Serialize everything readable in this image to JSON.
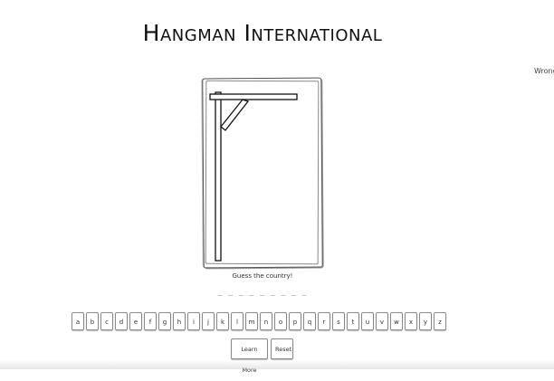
{
  "game": {
    "title": "Hangman International",
    "wrong_label": "Wrong gu",
    "prompt": "Guess the country!",
    "blanks": "_ _ _ _ _ _ _ _ _"
  },
  "keyboard": {
    "letters": [
      "a",
      "b",
      "c",
      "d",
      "e",
      "f",
      "g",
      "h",
      "i",
      "j",
      "k",
      "l",
      "m",
      "n",
      "o",
      "p",
      "q",
      "r",
      "s",
      "t",
      "u",
      "v",
      "w",
      "x",
      "y",
      "z"
    ]
  },
  "actions": {
    "learn_more": "Learn More",
    "reset": "Reset"
  },
  "colors": {
    "background": "#ffffff",
    "ink": "#222222",
    "border": "#8a8a8a"
  }
}
